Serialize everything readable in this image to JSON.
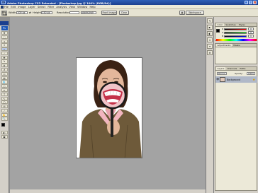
{
  "app": {
    "title": "Adobe Photoshop CS3 Extended - [Photoshop.jpg @ 100% (RGB/8#)]",
    "app_icon_letters": "Ps"
  },
  "window_controls": {
    "minimize": "_",
    "maximize": "□",
    "close": "×"
  },
  "menu": [
    "File",
    "Edit",
    "Image",
    "Layer",
    "Select",
    "Filter",
    "Analysis",
    "View",
    "Window",
    "Help"
  ],
  "options": {
    "width_label": "Width:",
    "width_value": "100 px",
    "height_label": "Height:",
    "height_value": "150 px",
    "resolution_label": "Resolution:",
    "resolution_value": "",
    "resolution_unit": "pixels/inch",
    "front_image": "Front Image",
    "clear": "Clear",
    "workspace": "Workspace"
  },
  "toolbox": {
    "logo": "Ps",
    "tools": [
      "move",
      "marquee",
      "lasso",
      "magic-wand",
      "crop",
      "slice",
      "healing",
      "brush",
      "stamp",
      "history-brush",
      "eraser",
      "gradient",
      "blur",
      "dodge",
      "pen",
      "type",
      "path-select",
      "shape",
      "notes",
      "eyedropper",
      "hand",
      "zoom"
    ],
    "tool_glyphs": [
      "✥",
      "⬚",
      "ↄ",
      "✶",
      "⌗",
      "⟋",
      "✚",
      "✎",
      "⧉",
      "↺",
      "▭",
      "▤",
      "💧",
      "○",
      "✒",
      "T",
      "↖",
      "▢",
      "✉",
      "⁄",
      "✋",
      "🔍"
    ],
    "foreground_color": "#000000",
    "background_color": "#ffffff"
  },
  "dock": {
    "buttons": [
      "history",
      "actions",
      "navigator",
      "info",
      "brushes",
      "tool-presets"
    ],
    "glyphs": [
      "⟲",
      "▶",
      "◧",
      "ℹ",
      "✦",
      "⚙"
    ]
  },
  "panels": {
    "color_tabs": [
      "Color",
      "Swatches",
      "Styles"
    ],
    "sliders": [
      {
        "label": "R",
        "value": "0",
        "color": "#cc2222"
      },
      {
        "label": "G",
        "value": "0",
        "color": "#22aa22"
      },
      {
        "label": "B",
        "value": "0",
        "color": "#2244cc"
      }
    ],
    "adjust_tabs": [
      "Adjustments",
      "Masks"
    ],
    "layers_tabs": [
      "Layers",
      "Channels",
      "Paths"
    ],
    "layer_name": "Background",
    "blend_mode": "Normal",
    "opacity_label": "Opacity:",
    "opacity_value": "100%"
  },
  "colors": {
    "titlebar": "#1b3f8f",
    "workspace": "#a3a3a3",
    "panel_bg": "#d4d0c8"
  }
}
